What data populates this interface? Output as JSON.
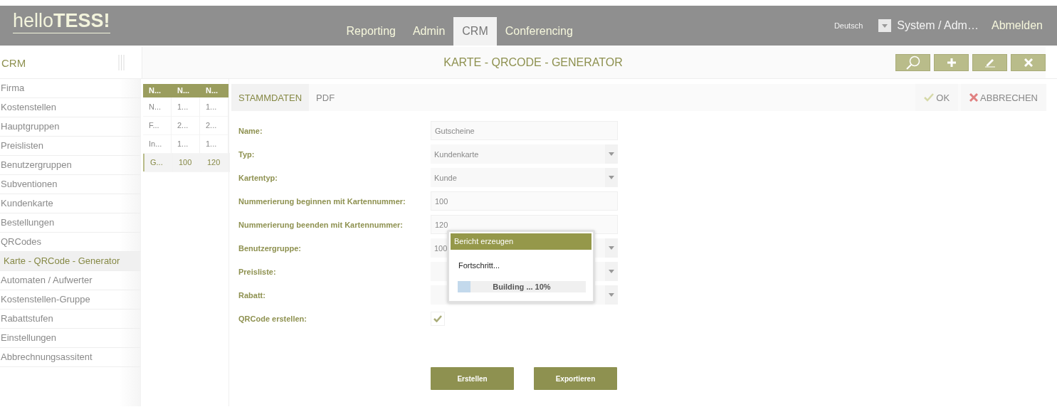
{
  "header": {
    "logo_light": "hello",
    "logo_bold": "TESS!",
    "nav": [
      {
        "label": "Reporting",
        "selected": false
      },
      {
        "label": "Admin",
        "selected": false
      },
      {
        "label": "CRM",
        "selected": true
      },
      {
        "label": "Conferencing",
        "selected": false
      }
    ],
    "language": "Deutsch",
    "user": "System / Adm…",
    "logout": "Abmelden"
  },
  "sidebar": {
    "title": "CRM",
    "items": [
      {
        "label": "Firma",
        "selected": false
      },
      {
        "label": "Kostenstellen",
        "selected": false
      },
      {
        "label": "Hauptgruppen",
        "selected": false
      },
      {
        "label": "Preislisten",
        "selected": false
      },
      {
        "label": "Benutzergruppen",
        "selected": false
      },
      {
        "label": "Subventionen",
        "selected": false
      },
      {
        "label": "Kundenkarte",
        "selected": false
      },
      {
        "label": "Bestellungen",
        "selected": false
      },
      {
        "label": "QRCodes",
        "selected": false
      },
      {
        "label": "Karte - QRCode - Generator",
        "selected": true
      },
      {
        "label": "Automaten / Aufwerter",
        "selected": false
      },
      {
        "label": "Kostenstellen-Gruppe",
        "selected": false
      },
      {
        "label": "Rabattstufen",
        "selected": false
      },
      {
        "label": "Einstellungen",
        "selected": false
      },
      {
        "label": "Abbrechnungsassitent",
        "selected": false
      }
    ]
  },
  "table": {
    "columns": [
      "N...",
      "N...",
      "N..."
    ],
    "rows": [
      {
        "cells": [
          "N...",
          "1...",
          "1..."
        ],
        "selected": false
      },
      {
        "cells": [
          "F...",
          "2...",
          "2..."
        ],
        "selected": false
      },
      {
        "cells": [
          "In...",
          "1...",
          "1..."
        ],
        "selected": false
      },
      {
        "cells": [
          "G...",
          "100",
          "120"
        ],
        "selected": true
      }
    ]
  },
  "title_bar": {
    "title": "KARTE - QRCODE - GENERATOR"
  },
  "form": {
    "tabs": [
      {
        "label": "STAMMDATEN",
        "selected": true
      },
      {
        "label": "PDF",
        "selected": false
      }
    ],
    "ok": "OK",
    "cancel": "ABBRECHEN",
    "fields": [
      {
        "label": "Name:",
        "kind": "text",
        "value": "Gutscheine"
      },
      {
        "label": "Typ:",
        "kind": "select",
        "value": "Kundenkarte"
      },
      {
        "label": "Kartentyp:",
        "kind": "select",
        "value": "Kunde"
      },
      {
        "label": "Nummerierung beginnen mit Kartennummer:",
        "kind": "text",
        "value": "100"
      },
      {
        "label": "Nummerierung beenden mit Kartennummer:",
        "kind": "text",
        "value": "120"
      },
      {
        "label": "Benutzergruppe:",
        "kind": "select",
        "value": "100"
      },
      {
        "label": "Preisliste:",
        "kind": "select"
      },
      {
        "label": "Rabatt:",
        "kind": "select"
      },
      {
        "label": "QRCode erstellen:",
        "kind": "checkbox",
        "checked": true
      }
    ],
    "buttons": [
      "Erstellen",
      "Exportieren"
    ]
  },
  "dialog": {
    "title": "Bericht erzeugen",
    "message": "Fortschritt...",
    "level": 0.1,
    "progress_text": "Building ... 10%"
  }
}
